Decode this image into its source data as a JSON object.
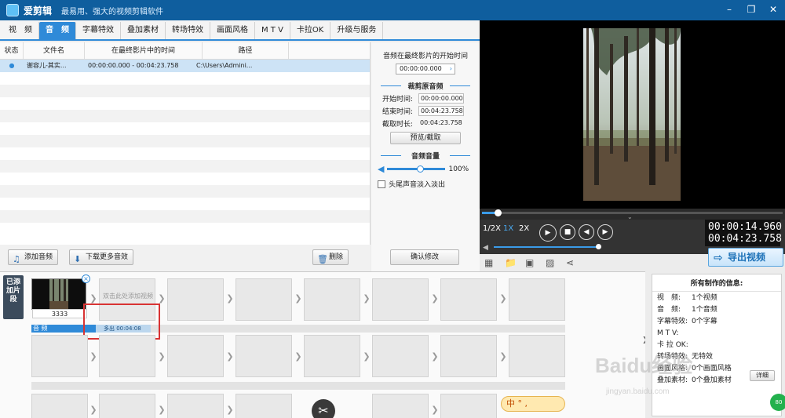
{
  "app": {
    "name": "爱剪辑",
    "slogan": "最易用、强大的视频剪辑软件",
    "minimize": "–",
    "maximize": "❐",
    "close": "✕"
  },
  "tabs": [
    "视　频",
    "音　频",
    "字幕特效",
    "叠加素材",
    "转场特效",
    "画面风格",
    "M T V",
    "卡拉OK",
    "升级与服务"
  ],
  "table": {
    "headers": [
      "状态",
      "文件名",
      "在最终影片中的时间",
      "路径"
    ],
    "rows": [
      {
        "status": "●",
        "name": "谢容儿-其实...",
        "time": "00:00:00.000 - 00:04:23.758",
        "path": "C:\\Users\\Admini..."
      }
    ]
  },
  "settings": {
    "start_title": "音频在最终影片的开始时间",
    "start_value": "00:00:00.000",
    "crop_title": "裁剪原音频",
    "start_label": "开始时间:",
    "start_time": "00:00:00.000",
    "end_label": "结束时间:",
    "end_time": "00:04:23.758",
    "duration_label": "截取时长:",
    "duration": "00:04:23.758",
    "preview_button": "预览/截取",
    "volume_title": "音频音量",
    "volume_value": "100%",
    "fade_label": "头尾声音淡入淡出",
    "confirm_button": "确认修改"
  },
  "bottom_buttons": {
    "add_audio": "添加音频",
    "download_more": "下载更多音效",
    "delete": "删除"
  },
  "player": {
    "speeds": [
      "1/2X",
      "1X",
      "2X"
    ],
    "current_time": "00:00:14.960",
    "total_time": "00:04:23.758",
    "export_button": "导出视频"
  },
  "timeline": {
    "added_tab": "已添加片段",
    "first_clip_caption": "3333",
    "hint": "双击此处添加视频",
    "audio_label": "音  频",
    "audio_item": "多出 00:04:08",
    "ime": "中 ° ,"
  },
  "info": {
    "title": "所有制作的信息:",
    "rows": [
      {
        "k": "视　频:",
        "v": "1个视频"
      },
      {
        "k": "音　频:",
        "v": "1个音频"
      },
      {
        "k": "字幕特效:",
        "v": "0个字幕"
      },
      {
        "k": "M T V:",
        "v": ""
      },
      {
        "k": "卡 拉 OK:",
        "v": ""
      },
      {
        "k": "转场特效:",
        "v": "无特效"
      },
      {
        "k": "画面风格:",
        "v": "0个画面风格"
      },
      {
        "k": "叠加素材:",
        "v": "0个叠加素材"
      }
    ],
    "detail_button": "详细",
    "badge": "80"
  },
  "watermark": {
    "brand": "Baidu经验",
    "url": "jingyan.baidu.com"
  }
}
